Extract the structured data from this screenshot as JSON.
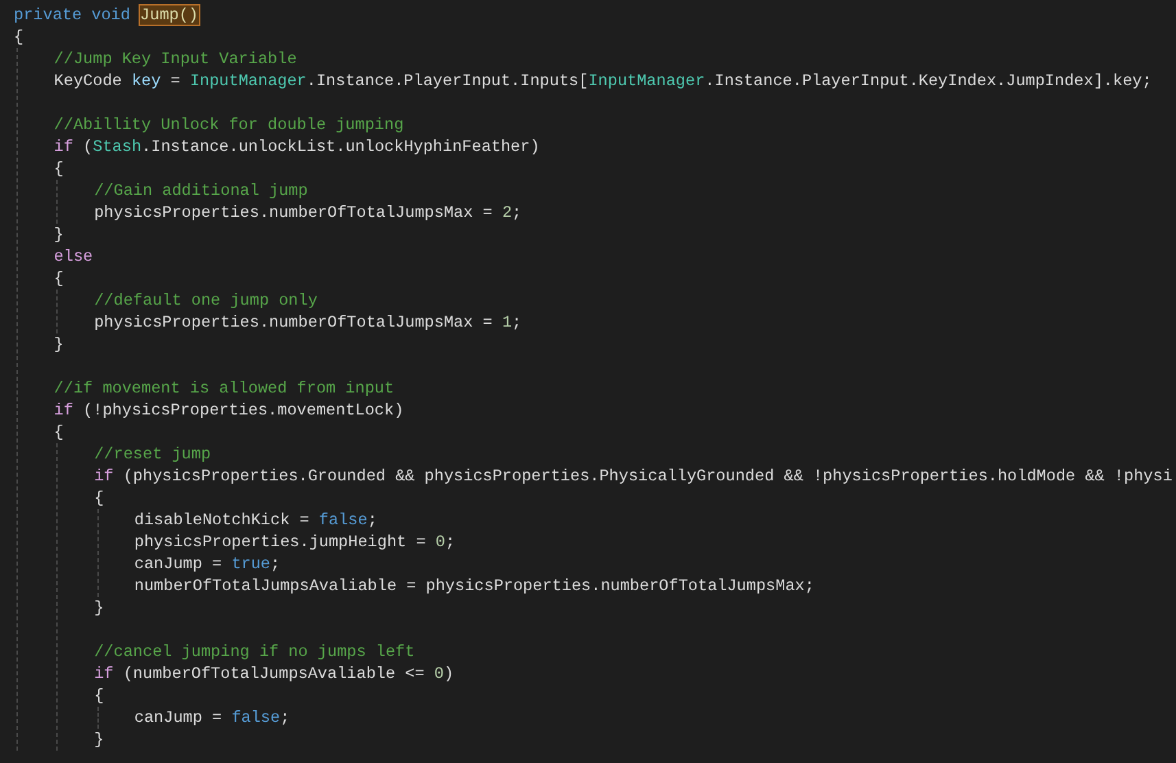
{
  "editor": {
    "lines": [
      {
        "kind": "code",
        "tokens": [
          {
            "t": "private void ",
            "kind": "keyword"
          },
          {
            "t": "Jump()",
            "kind": "method",
            "highlighted": true
          }
        ]
      },
      {
        "kind": "code",
        "tokens": [
          {
            "t": "{",
            "kind": "plain"
          }
        ],
        "children": [
          {
            "kind": "code",
            "tokens": [
              {
                "t": "//Jump Key Input Variable",
                "kind": "comment"
              }
            ]
          },
          {
            "kind": "code",
            "tokens": [
              {
                "t": "KeyCode ",
                "kind": "plain"
              },
              {
                "t": "key",
                "kind": "variable"
              },
              {
                "t": " = ",
                "kind": "plain"
              },
              {
                "t": "InputManager",
                "kind": "type"
              },
              {
                "t": ".Instance.PlayerInput.Inputs[",
                "kind": "plain"
              },
              {
                "t": "InputManager",
                "kind": "type"
              },
              {
                "t": ".Instance.PlayerInput.KeyIndex.JumpIndex].key;",
                "kind": "plain"
              }
            ]
          },
          {
            "kind": "blank"
          },
          {
            "kind": "code",
            "tokens": [
              {
                "t": "//Abillity Unlock for double jumping",
                "kind": "comment"
              }
            ]
          },
          {
            "kind": "code",
            "tokens": [
              {
                "t": "if",
                "kind": "control"
              },
              {
                "t": " (",
                "kind": "plain"
              },
              {
                "t": "Stash",
                "kind": "type"
              },
              {
                "t": ".Instance.unlockList.unlockHyphinFeather)",
                "kind": "plain"
              }
            ]
          },
          {
            "kind": "code",
            "tokens": [
              {
                "t": "{",
                "kind": "plain"
              }
            ],
            "children": [
              {
                "kind": "code",
                "tokens": [
                  {
                    "t": "//Gain additional jump",
                    "kind": "comment"
                  }
                ]
              },
              {
                "kind": "code",
                "tokens": [
                  {
                    "t": "physicsProperties.numberOfTotalJumpsMax = ",
                    "kind": "plain"
                  },
                  {
                    "t": "2",
                    "kind": "number"
                  },
                  {
                    "t": ";",
                    "kind": "plain"
                  }
                ]
              }
            ]
          },
          {
            "kind": "code",
            "tokens": [
              {
                "t": "}",
                "kind": "plain"
              }
            ]
          },
          {
            "kind": "code",
            "tokens": [
              {
                "t": "else",
                "kind": "control"
              }
            ]
          },
          {
            "kind": "code",
            "tokens": [
              {
                "t": "{",
                "kind": "plain"
              }
            ],
            "children": [
              {
                "kind": "code",
                "tokens": [
                  {
                    "t": "//default one jump only",
                    "kind": "comment"
                  }
                ]
              },
              {
                "kind": "code",
                "tokens": [
                  {
                    "t": "physicsProperties.numberOfTotalJumpsMax = ",
                    "kind": "plain"
                  },
                  {
                    "t": "1",
                    "kind": "number"
                  },
                  {
                    "t": ";",
                    "kind": "plain"
                  }
                ]
              }
            ]
          },
          {
            "kind": "code",
            "tokens": [
              {
                "t": "}",
                "kind": "plain"
              }
            ]
          },
          {
            "kind": "blank"
          },
          {
            "kind": "code",
            "tokens": [
              {
                "t": "//if movement is allowed from input",
                "kind": "comment"
              }
            ]
          },
          {
            "kind": "code",
            "tokens": [
              {
                "t": "if",
                "kind": "control"
              },
              {
                "t": " (!physicsProperties.movementLock)",
                "kind": "plain"
              }
            ]
          },
          {
            "kind": "code",
            "tokens": [
              {
                "t": "{",
                "kind": "plain"
              }
            ],
            "children": [
              {
                "kind": "code",
                "tokens": [
                  {
                    "t": "//reset jump",
                    "kind": "comment"
                  }
                ]
              },
              {
                "kind": "code",
                "tokens": [
                  {
                    "t": "if",
                    "kind": "control"
                  },
                  {
                    "t": " (physicsProperties.Grounded && physicsProperties.PhysicallyGrounded && !physicsProperties.holdMode && !physi",
                    "kind": "plain"
                  }
                ]
              },
              {
                "kind": "code",
                "tokens": [
                  {
                    "t": "{",
                    "kind": "plain"
                  }
                ],
                "children": [
                  {
                    "kind": "code",
                    "tokens": [
                      {
                        "t": "disableNotchKick = ",
                        "kind": "plain"
                      },
                      {
                        "t": "false",
                        "kind": "keyword"
                      },
                      {
                        "t": ";",
                        "kind": "plain"
                      }
                    ]
                  },
                  {
                    "kind": "code",
                    "tokens": [
                      {
                        "t": "physicsProperties.jumpHeight = ",
                        "kind": "plain"
                      },
                      {
                        "t": "0",
                        "kind": "number"
                      },
                      {
                        "t": ";",
                        "kind": "plain"
                      }
                    ]
                  },
                  {
                    "kind": "code",
                    "tokens": [
                      {
                        "t": "canJump = ",
                        "kind": "plain"
                      },
                      {
                        "t": "true",
                        "kind": "keyword"
                      },
                      {
                        "t": ";",
                        "kind": "plain"
                      }
                    ]
                  },
                  {
                    "kind": "code",
                    "tokens": [
                      {
                        "t": "numberOfTotalJumpsAvaliable = physicsProperties.numberOfTotalJumpsMax;",
                        "kind": "plain"
                      }
                    ]
                  }
                ]
              },
              {
                "kind": "code",
                "tokens": [
                  {
                    "t": "}",
                    "kind": "plain"
                  }
                ]
              },
              {
                "kind": "blank"
              },
              {
                "kind": "code",
                "tokens": [
                  {
                    "t": "//cancel jumping if no jumps left",
                    "kind": "comment"
                  }
                ]
              },
              {
                "kind": "code",
                "tokens": [
                  {
                    "t": "if",
                    "kind": "control"
                  },
                  {
                    "t": " (numberOfTotalJumpsAvaliable <= ",
                    "kind": "plain"
                  },
                  {
                    "t": "0",
                    "kind": "number"
                  },
                  {
                    "t": ")",
                    "kind": "plain"
                  }
                ]
              },
              {
                "kind": "code",
                "tokens": [
                  {
                    "t": "{",
                    "kind": "plain"
                  }
                ],
                "children": [
                  {
                    "kind": "code",
                    "tokens": [
                      {
                        "t": "canJump = ",
                        "kind": "plain"
                      },
                      {
                        "t": "false",
                        "kind": "keyword"
                      },
                      {
                        "t": ";",
                        "kind": "plain"
                      }
                    ]
                  }
                ]
              },
              {
                "kind": "code",
                "tokens": [
                  {
                    "t": "}",
                    "kind": "plain"
                  }
                ]
              }
            ]
          }
        ]
      }
    ]
  }
}
